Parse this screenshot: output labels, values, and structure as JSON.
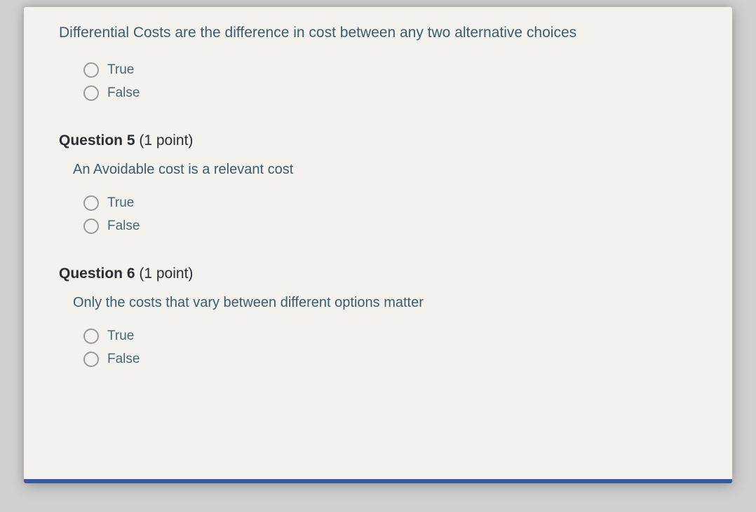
{
  "q4": {
    "prompt": "Differential Costs are the difference in cost between any two alternative choices",
    "options": [
      "True",
      "False"
    ]
  },
  "q5": {
    "header_label": "Question 5",
    "points": " (1 point)",
    "prompt": "An Avoidable cost is a relevant cost",
    "options": [
      "True",
      "False"
    ]
  },
  "q6": {
    "header_label": "Question 6",
    "points": " (1 point)",
    "prompt": "Only the costs that vary between different options matter",
    "options": [
      "True",
      "False"
    ]
  }
}
